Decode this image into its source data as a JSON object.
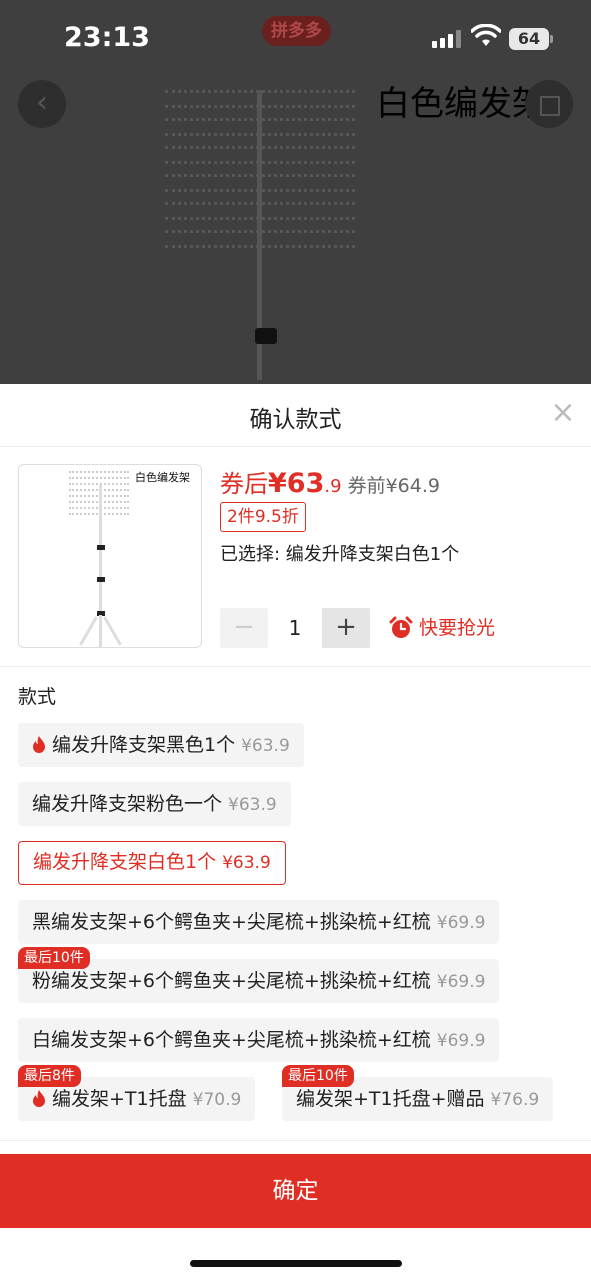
{
  "status": {
    "time": "23:13",
    "app_name": "拼多多",
    "battery": "64"
  },
  "hero": {
    "title": "白色编发架"
  },
  "sheet": {
    "title": "确认款式",
    "close_glyph": "×",
    "thumb_title": "白色编发架",
    "price_after_label": "券后",
    "price_main": "¥63",
    "price_decimal": ".9",
    "price_before": "券前¥64.9",
    "discount": "2件9.5折",
    "selected": "已选择: 编发升降支架白色1个",
    "qty_minus": "−",
    "qty_value": "1",
    "qty_plus": "+",
    "stock_warning": "快要抢光",
    "section_label": "款式",
    "confirm": "确定"
  },
  "options": [
    {
      "label": "编发升降支架黑色1个",
      "price": "¥63.9",
      "hot": true,
      "badge": ""
    },
    {
      "label": "编发升降支架粉色一个",
      "price": "¥63.9",
      "hot": false,
      "badge": ""
    },
    {
      "label": "编发升降支架白色1个",
      "price": "¥63.9",
      "hot": false,
      "badge": "",
      "selected": true
    },
    {
      "label": "黑编发支架+6个鳄鱼夹+尖尾梳+挑染梳+红梳",
      "price": "¥69.9",
      "hot": false,
      "badge": ""
    },
    {
      "label": "粉编发支架+6个鳄鱼夹+尖尾梳+挑染梳+红梳",
      "price": "¥69.9",
      "hot": false,
      "badge": "最后10件"
    },
    {
      "label": "白编发支架+6个鳄鱼夹+尖尾梳+挑染梳+红梳",
      "price": "¥69.9",
      "hot": false,
      "badge": ""
    },
    {
      "label": "编发架+T1托盘",
      "price": "¥70.9",
      "hot": true,
      "badge": "最后8件"
    },
    {
      "label": "编发架+T1托盘+赠品",
      "price": "¥76.9",
      "hot": false,
      "badge": "最后10件"
    }
  ],
  "colors": {
    "accent": "#e02e24",
    "chip_bg": "#f4f4f4",
    "overlay": "#3f3f3f"
  }
}
